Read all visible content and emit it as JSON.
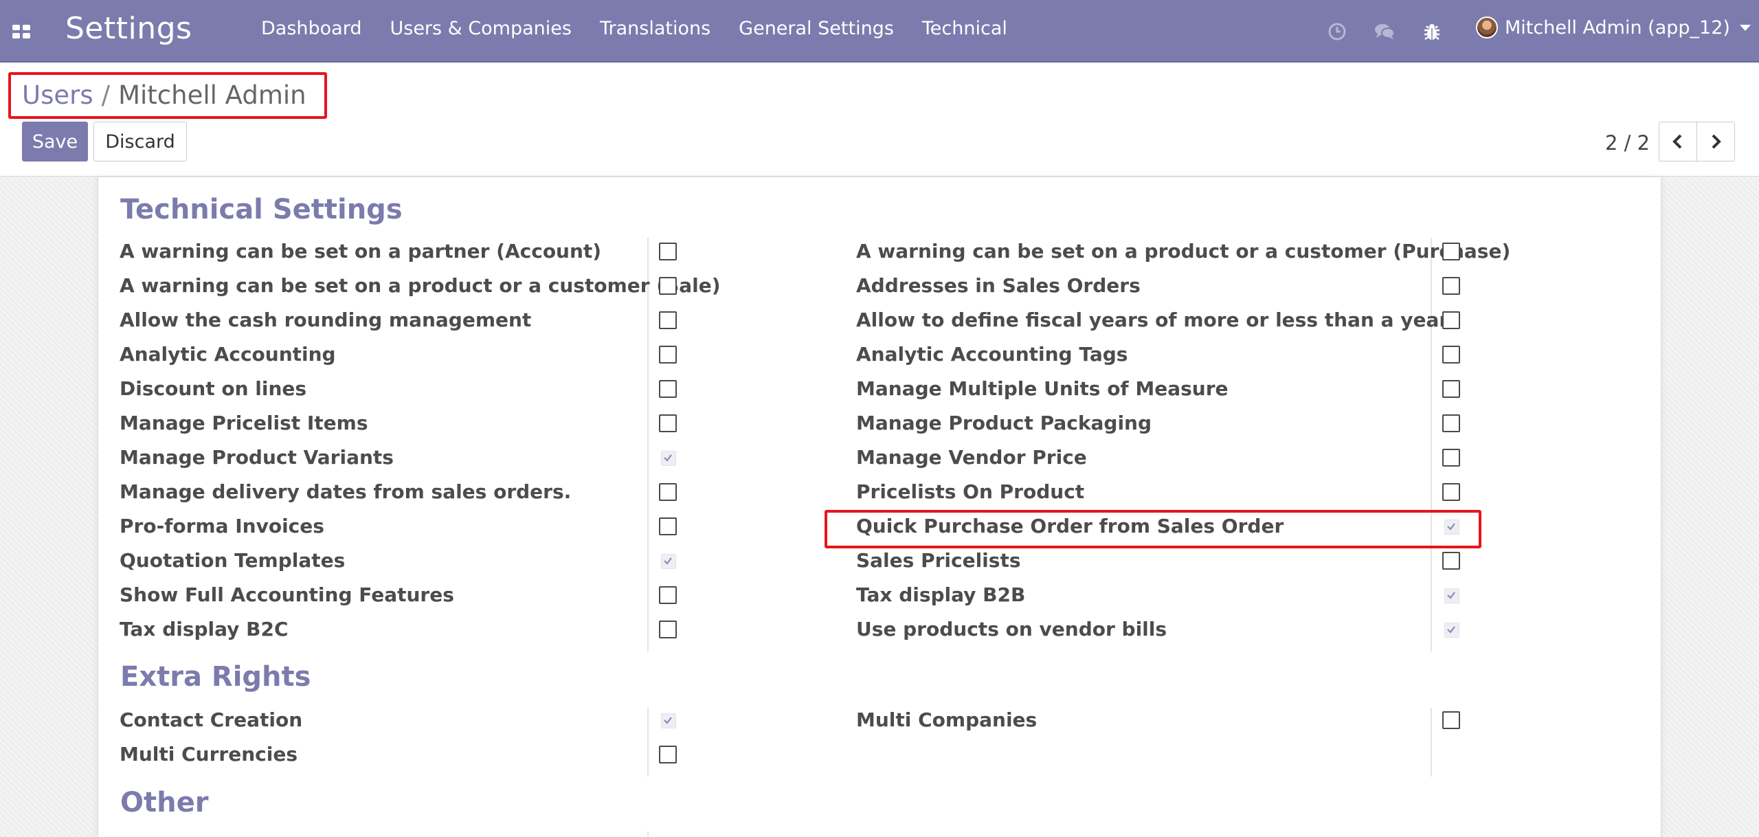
{
  "navbar": {
    "app_title": "Settings",
    "menu": [
      "Dashboard",
      "Users & Companies",
      "Translations",
      "General Settings",
      "Technical"
    ],
    "icons": [
      "clock-icon",
      "chat-icon",
      "bug-icon"
    ],
    "user_name": "Mitchell Admin (app_12)",
    "color": "#7c7bad"
  },
  "breadcrumb": {
    "parent": "Users",
    "separator": "/",
    "current": "Mitchell Admin"
  },
  "toolbar": {
    "save_label": "Save",
    "discard_label": "Discard"
  },
  "pager": {
    "value": "2 / 2"
  },
  "sections": {
    "technical": {
      "title": "Technical Settings",
      "left": [
        {
          "label": "A warning can be set on a partner (Account)",
          "checked": false
        },
        {
          "label": "A warning can be set on a product or a customer (Sale)",
          "checked": false
        },
        {
          "label": "Allow the cash rounding management",
          "checked": false
        },
        {
          "label": "Analytic Accounting",
          "checked": false
        },
        {
          "label": "Discount on lines",
          "checked": false
        },
        {
          "label": "Manage Pricelist Items",
          "checked": false
        },
        {
          "label": "Manage Product Variants",
          "checked": true
        },
        {
          "label": "Manage delivery dates from sales orders.",
          "checked": false
        },
        {
          "label": "Pro-forma Invoices",
          "checked": false
        },
        {
          "label": "Quotation Templates",
          "checked": true
        },
        {
          "label": "Show Full Accounting Features",
          "checked": false
        },
        {
          "label": "Tax display B2C",
          "checked": false
        }
      ],
      "right": [
        {
          "label": "A warning can be set on a product or a customer (Purchase)",
          "checked": false
        },
        {
          "label": "Addresses in Sales Orders",
          "checked": false
        },
        {
          "label": "Allow to define fiscal years of more or less than a year",
          "checked": false
        },
        {
          "label": "Analytic Accounting Tags",
          "checked": false
        },
        {
          "label": "Manage Multiple Units of Measure",
          "checked": false
        },
        {
          "label": "Manage Product Packaging",
          "checked": false
        },
        {
          "label": "Manage Vendor Price",
          "checked": false
        },
        {
          "label": "Pricelists On Product",
          "checked": false
        },
        {
          "label": "Quick Purchase Order from Sales Order",
          "checked": true
        },
        {
          "label": "Sales Pricelists",
          "checked": false
        },
        {
          "label": "Tax display B2B",
          "checked": true
        },
        {
          "label": "Use products on vendor bills",
          "checked": true
        }
      ]
    },
    "extra": {
      "title": "Extra Rights",
      "left": [
        {
          "label": "Contact Creation",
          "checked": true
        },
        {
          "label": "Multi Currencies",
          "checked": false
        }
      ],
      "right": [
        {
          "label": "Multi Companies",
          "checked": false
        }
      ]
    },
    "other": {
      "title": "Other"
    }
  },
  "highlight_color": "#e8141b"
}
